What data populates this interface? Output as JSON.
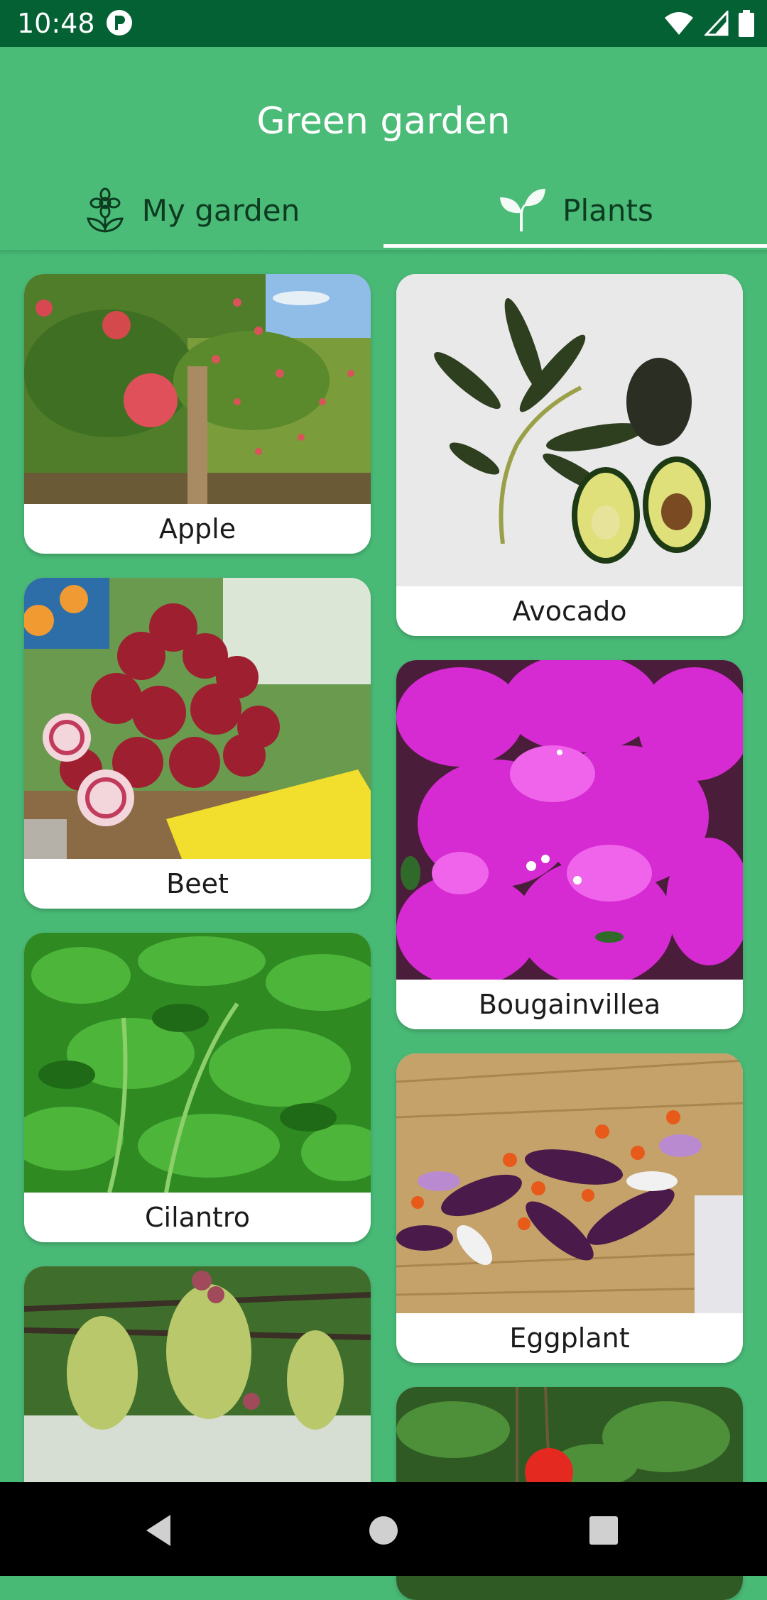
{
  "status_bar": {
    "time": "10:48",
    "icons": [
      "app-notification-icon",
      "wifi-icon",
      "cell-signal-icon",
      "battery-icon"
    ]
  },
  "app": {
    "title": "Green garden"
  },
  "tabs": [
    {
      "label": "My garden",
      "icon": "flower-icon",
      "selected": false
    },
    {
      "label": "Plants",
      "icon": "sprout-icon",
      "selected": true
    }
  ],
  "plants": [
    {
      "name": "Apple"
    },
    {
      "name": "Avocado"
    },
    {
      "name": "Beet"
    },
    {
      "name": "Bougainvillea"
    },
    {
      "name": "Cilantro"
    },
    {
      "name": "Eggplant"
    }
  ],
  "colors": {
    "primary": "#4bbb78",
    "status_bar": "#046134",
    "background": "#49b976",
    "indicator": "#ffffff"
  },
  "nav_bar": {
    "buttons": [
      "back-icon",
      "home-icon",
      "recents-icon"
    ]
  }
}
